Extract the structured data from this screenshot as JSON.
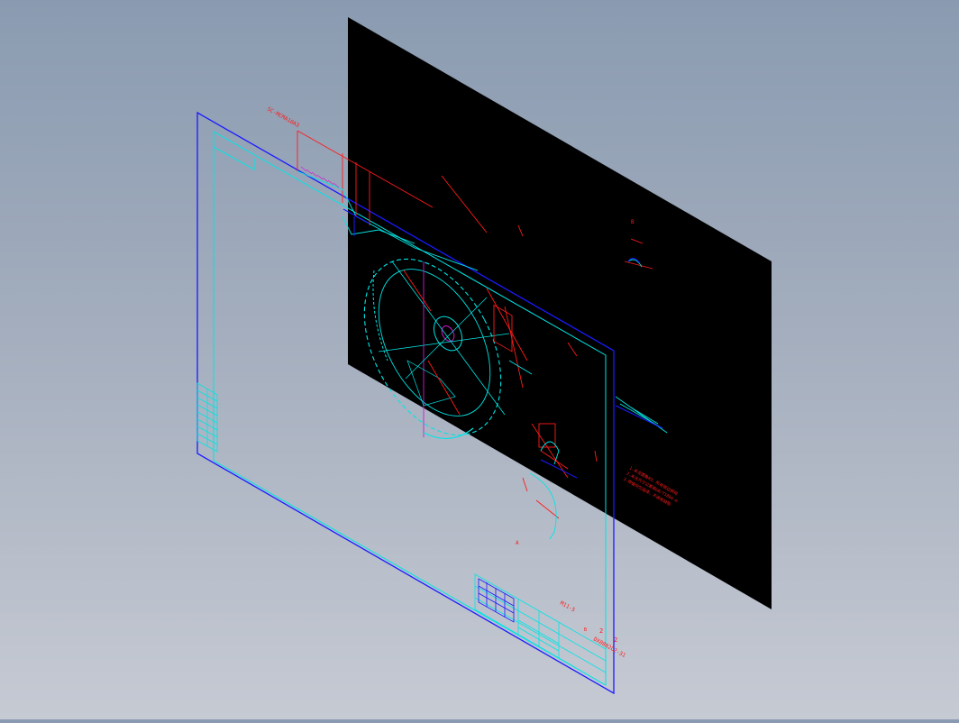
{
  "viewport": {
    "background_top": "#8a9bb1",
    "background_bottom": "#c6cad3"
  },
  "sheet": {
    "fill": "#000000",
    "frame_color": "#1a1aff",
    "inner_frame_color": "#00e5e5"
  },
  "colors": {
    "geometry_red": "#ff1a1a",
    "geometry_cyan": "#00e5e5",
    "geometry_magenta": "#d21ad2",
    "geometry_blue": "#1a1aff"
  },
  "annotations": {
    "top_label": "SC-MCMA10A3",
    "section_label": "A",
    "detail_label": "B",
    "part_label": "B",
    "title_code": "M11-5",
    "drawing_number": "DX0802L2-31",
    "notes": [
      "1.未注圆角R3，所有锐边倒钝",
      "2.未注尺寸公差按GB/T1804-m",
      "3.焊缝均匀连续，不得有缺陷"
    ],
    "marker_a": "2",
    "marker_b": "2"
  }
}
